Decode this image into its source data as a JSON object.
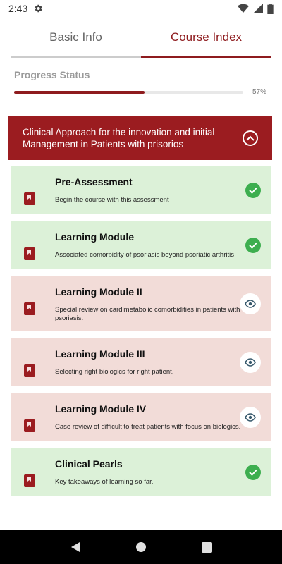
{
  "status_bar": {
    "time": "2:43"
  },
  "tabs": [
    {
      "label": "Basic Info",
      "active": false
    },
    {
      "label": "Course Index",
      "active": true
    }
  ],
  "progress": {
    "label": "Progress Status",
    "percent_text": "57%",
    "value": 0.57
  },
  "section": {
    "title": "Clinical Approach for the innovation and initial Management in Patients with prisorios"
  },
  "items": [
    {
      "title": "Pre-Assessment",
      "desc": "Begin the course with this assessment",
      "status": "done"
    },
    {
      "title": "Learning Module",
      "desc": "Associated comorbidity of psoriasis beyond psoriatic arthritis",
      "status": "done"
    },
    {
      "title": "Learning Module II",
      "desc": "Special review on cardimetabolic comorbidities in patients with psoriasis.",
      "status": "view"
    },
    {
      "title": "Learning Module III",
      "desc": "Selecting right biologics for right patient.",
      "status": "view"
    },
    {
      "title": "Learning Module IV",
      "desc": "Case review of difficult to treat patients with focus on biologics.",
      "status": "view"
    },
    {
      "title": "Clinical Pearls",
      "desc": "Key takeaways of learning so far.",
      "status": "done"
    }
  ],
  "colors": {
    "accent": "#8e1b1e",
    "done_bg": "#dcf1d8",
    "pending_bg": "#f2dcd8",
    "check": "#3dae4f"
  }
}
